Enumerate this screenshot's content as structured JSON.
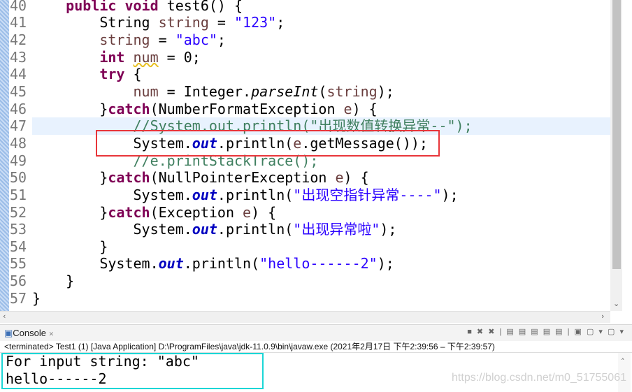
{
  "editor": {
    "lines": [
      {
        "n": "40",
        "t": [
          [
            "    ",
            ""
          ],
          [
            "public void ",
            "kw"
          ],
          [
            "test6() {",
            ""
          ]
        ]
      },
      {
        "n": "41",
        "t": [
          [
            "        String ",
            ""
          ],
          [
            "string",
            "var"
          ],
          [
            " = ",
            ""
          ],
          [
            "\"123\"",
            "str"
          ],
          [
            ";",
            ""
          ]
        ]
      },
      {
        "n": "42",
        "t": [
          [
            "        ",
            ""
          ],
          [
            "string",
            "var"
          ],
          [
            " = ",
            ""
          ],
          [
            "\"abc\"",
            "str"
          ],
          [
            ";",
            ""
          ]
        ]
      },
      {
        "n": "43",
        "t": [
          [
            "        ",
            ""
          ],
          [
            "int ",
            "kw"
          ],
          [
            "num",
            "var warn"
          ],
          [
            " = 0;",
            ""
          ]
        ]
      },
      {
        "n": "44",
        "t": [
          [
            "        ",
            ""
          ],
          [
            "try",
            "kw"
          ],
          [
            " {",
            ""
          ]
        ]
      },
      {
        "n": "45",
        "t": [
          [
            "            ",
            ""
          ],
          [
            "num",
            "var"
          ],
          [
            " = Integer.",
            ""
          ],
          [
            "parseInt",
            "it"
          ],
          [
            "(",
            ""
          ],
          [
            "string",
            "var"
          ],
          [
            ");",
            ""
          ]
        ]
      },
      {
        "n": "46",
        "t": [
          [
            "        }",
            ""
          ],
          [
            "catch",
            "kw"
          ],
          [
            "(NumberFormatException ",
            ""
          ],
          [
            "e",
            "var"
          ],
          [
            ") {",
            ""
          ]
        ]
      },
      {
        "n": "47",
        "cur": true,
        "t": [
          [
            "            ",
            ""
          ],
          [
            "//System.out.println(\"出现数值转换异常--\");",
            "cm"
          ]
        ]
      },
      {
        "n": "48",
        "t": [
          [
            "            System.",
            ""
          ],
          [
            "out",
            "fld"
          ],
          [
            ".println(",
            ""
          ],
          [
            "e",
            "var"
          ],
          [
            ".getMessage());",
            ""
          ]
        ]
      },
      {
        "n": "49",
        "t": [
          [
            "            ",
            ""
          ],
          [
            "//e.printStackTrace();",
            "cm"
          ]
        ]
      },
      {
        "n": "50",
        "t": [
          [
            "        }",
            ""
          ],
          [
            "catch",
            "kw"
          ],
          [
            "(NullPointerException ",
            ""
          ],
          [
            "e",
            "var"
          ],
          [
            ") {",
            ""
          ]
        ]
      },
      {
        "n": "51",
        "t": [
          [
            "            System.",
            ""
          ],
          [
            "out",
            "fld"
          ],
          [
            ".println(",
            ""
          ],
          [
            "\"出现空指针异常----\"",
            "str"
          ],
          [
            ");",
            ""
          ]
        ]
      },
      {
        "n": "52",
        "t": [
          [
            "        }",
            ""
          ],
          [
            "catch",
            "kw"
          ],
          [
            "(Exception ",
            ""
          ],
          [
            "e",
            "var"
          ],
          [
            ") {",
            ""
          ]
        ]
      },
      {
        "n": "53",
        "t": [
          [
            "            System.",
            ""
          ],
          [
            "out",
            "fld"
          ],
          [
            ".println(",
            ""
          ],
          [
            "\"出现异常啦\"",
            "str"
          ],
          [
            ");",
            ""
          ]
        ]
      },
      {
        "n": "54",
        "t": [
          [
            "        }",
            ""
          ]
        ]
      },
      {
        "n": "55",
        "t": [
          [
            "        System.",
            ""
          ],
          [
            "out",
            "fld"
          ],
          [
            ".println(",
            ""
          ],
          [
            "\"hello------2\"",
            "str"
          ],
          [
            ");",
            ""
          ]
        ]
      },
      {
        "n": "56",
        "t": [
          [
            "    }",
            ""
          ]
        ]
      },
      {
        "n": "57",
        "t": [
          [
            "}",
            ""
          ]
        ]
      }
    ]
  },
  "console": {
    "tab_label": "Console",
    "close_glyph": "✕",
    "toolbar_glyphs": "■ ✖ ✖ | ▤ ▤ ▤ ▤ ▤ | ▣ ▢ ▾ ▢ ▾",
    "status": "<terminated> Test1 (1) [Java Application] D:\\ProgramFiles\\java\\jdk-11.0.9\\bin\\javaw.exe  (2021年2月17日 下午2:39:56 – 下午2:39:57)",
    "output": [
      "For input string: \"abc\"",
      "hello------2"
    ],
    "watermark": "https://blog.csdn.net/m0_51755061"
  },
  "colors": {
    "highlight_box": "#e8353a",
    "output_box": "#1bd6d6"
  }
}
